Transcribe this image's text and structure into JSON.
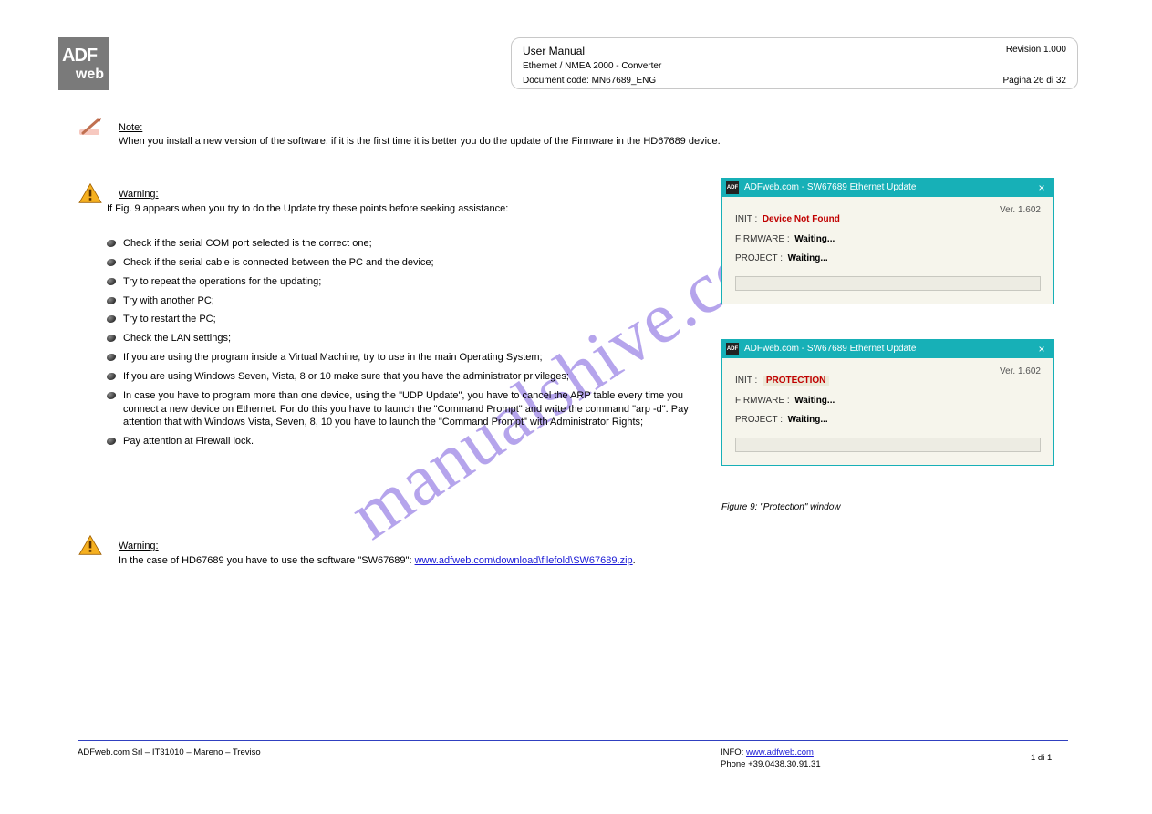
{
  "logo": {
    "line1": "ADF",
    "line2": "web"
  },
  "docbox": {
    "title": "User Manual",
    "product": "Ethernet / NMEA 2000 - Converter",
    "rev": "Revision 1.000",
    "doc": "Document code: MN67689_ENG",
    "page": "Pagina 26 di 32"
  },
  "note_label": "Note:",
  "note_text": "When you install a new version of the software, if it is the first time it is better you do the update of the Firmware in the HD67689 device.",
  "warning1_label": "Warning:",
  "warning1_intro": "If Fig. 9 appears when you try to do the Update try these points before seeking assistance:",
  "bullets": [
    "Check if the serial COM port selected is the correct one;",
    "Check if the serial cable is connected between the PC and the device;",
    "Try to repeat the operations for the updating;",
    "Try with another PC;",
    "Try to restart the PC;",
    "Check the LAN settings;",
    "If you are using the program inside a Virtual Machine, try to use in the main Operating System;",
    "If you are using Windows Seven, Vista, 8 or 10 make sure that you have the administrator privileges;",
    "In case you have to program more than one device, using the \"UDP Update\", you have to cancel the ARP table every time you connect a new device on Ethernet. For do this you have to launch the \"Command Prompt\" and write the command \"arp -d\". Pay attention that with Windows Vista, Seven, 8, 10 you have to launch the \"Command Prompt\" with Administrator Rights;",
    "Pay attention at Firewall lock."
  ],
  "figure_caption": "Figure 9: \"Protection\" window",
  "warning2_label": "Warning:",
  "warning2_text_before": "In the case of HD67689 you have to use the software \"SW67689\": ",
  "warning2_link_text": "www.adfweb.com\\download\\filefold\\SW67689.zip",
  "warning2_link_href_display": "www.adfweb.com\\download\\filefold\\SW67689.zip",
  "dialog": {
    "title": "ADFweb.com - SW67689 Ethernet Update",
    "version": "Ver. 1.602",
    "init_label": "INIT :",
    "firmware_label": "FIRMWARE :",
    "project_label": "PROJECT :",
    "waiting": "Waiting...",
    "status1": "Device Not Found",
    "status2": "PROTECTION"
  },
  "footer": {
    "left1": " ADFweb.com Srl – IT31010 – Mareno – Treviso",
    "left2": "INFO:",
    "left_link": "www.adfweb.com",
    "right1": "Phone +39.0438.30.91.31",
    "right2": "1 di 1",
    "farright": ""
  },
  "watermark": "manualshive.com"
}
